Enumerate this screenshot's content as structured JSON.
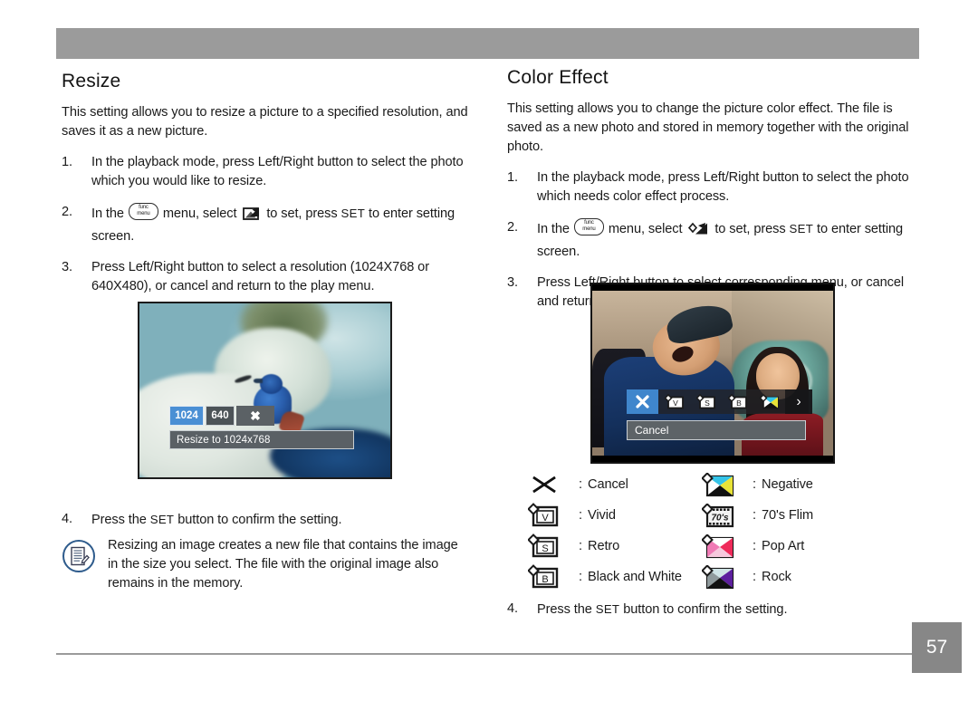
{
  "document": {
    "page_number": "57"
  },
  "left_column": {
    "title": "Resize",
    "intro": "This setting allows you to resize a picture to a specified resolution, and saves it as a new picture.",
    "steps": [
      {
        "num": "1.",
        "text": "In the playback mode, press Left/Right button to select the photo which you would like to resize."
      },
      {
        "num": "2.",
        "pre": "In the",
        "mid": "menu, select",
        "post": "to set, press",
        "set_word": "SET",
        "tail": "to enter setting screen.",
        "button_icon_line1": "func",
        "button_icon_line2": "menu",
        "select_icon": "resize-picture-icon"
      },
      {
        "num": "3.",
        "text": "Press Left/Right button to select a resolution (1024X768 or 640X480), or cancel and return to the play menu."
      }
    ],
    "step4": {
      "num": "4.",
      "pre": "Press the",
      "set_word": "SET",
      "post": "button to confirm the setting."
    },
    "note": {
      "icon": "note-document-pencil-icon",
      "text": "Resizing an image creates a new file that contains the image in the size you select. The file with the original image also remains in the memory."
    },
    "screenshot": {
      "name": "camera-resize-screen",
      "chips": [
        {
          "label": "1024",
          "selected": true
        },
        {
          "label": "640",
          "selected": false
        },
        {
          "label": "✖",
          "selected": false,
          "icon": "close-icon"
        }
      ],
      "caption": "Resize to 1024x768"
    }
  },
  "right_column": {
    "title": "Color Effect",
    "intro": "This setting allows you to change the picture color effect. The file is saved as a new photo and stored in memory together with the original photo.",
    "steps": [
      {
        "num": "1.",
        "text": "In the playback mode, press Left/Right button to select the photo which needs color effect process."
      },
      {
        "num": "2.",
        "pre": "In the",
        "mid": "menu, select",
        "post": "to set, press",
        "set_word": "SET",
        "tail": "to enter setting screen.",
        "button_icon_line1": "func",
        "button_icon_line2": "menu",
        "select_icon": "color-effect-icon"
      },
      {
        "num": "3.",
        "text": "Press Left/Right button to select corresponding menu, or cancel and return playback menu."
      }
    ],
    "step4": {
      "num": "4.",
      "pre": "Press the",
      "set_word": "SET",
      "post": "button to confirm the setting."
    },
    "screenshot": {
      "name": "camera-color-effect-screen",
      "menu_items": [
        {
          "icon": "cancel-x-icon",
          "selected": true
        },
        {
          "icon": "vivid-icon",
          "selected": false
        },
        {
          "icon": "retro-icon",
          "selected": false
        },
        {
          "icon": "black-and-white-icon",
          "selected": false
        },
        {
          "icon": "negative-icon",
          "selected": false
        }
      ],
      "arrow": "›",
      "caption": "Cancel"
    },
    "legend": {
      "colon": ":",
      "rows": [
        {
          "left": {
            "icon": "cancel-x-icon",
            "label": "Cancel"
          },
          "right": {
            "icon": "negative-icon",
            "label": "Negative"
          }
        },
        {
          "left": {
            "icon": "vivid-icon",
            "label": "Vivid",
            "letter": "V"
          },
          "right": {
            "icon": "seventies-film-icon",
            "label": "70's Flim",
            "letter": "70's"
          }
        },
        {
          "left": {
            "icon": "retro-icon",
            "label": "Retro",
            "letter": "S"
          },
          "right": {
            "icon": "pop-art-icon",
            "label": "Pop Art"
          }
        },
        {
          "left": {
            "icon": "black-and-white-icon",
            "label": "Black and White",
            "letter": "B"
          },
          "right": {
            "icon": "rock-icon",
            "label": "Rock"
          }
        }
      ]
    }
  },
  "colors": {
    "header_bar": "#9b9b9b",
    "footer_rule": "#9b9b9b",
    "page_num_bg": "#878787",
    "osd_selected": "#4a8fd4",
    "osd_normal": "#4c5357",
    "note_icon": "#2e5b8c"
  }
}
